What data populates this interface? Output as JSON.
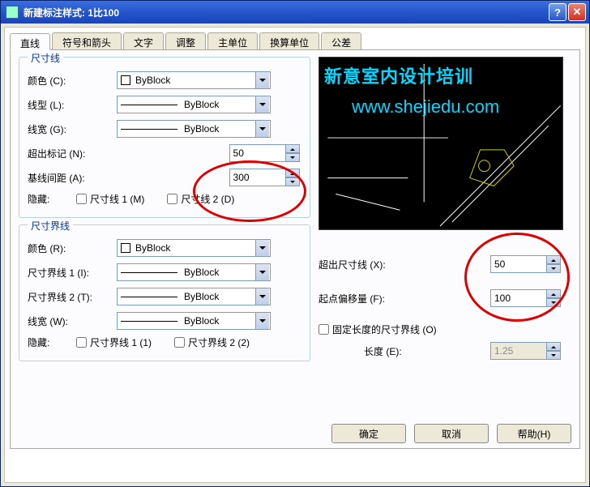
{
  "window": {
    "title": "新建标注样式: 1比100"
  },
  "tabs": [
    "直线",
    "符号和箭头",
    "文字",
    "调整",
    "主单位",
    "换算单位",
    "公差"
  ],
  "dimline": {
    "legend": "尺寸线",
    "color_label": "颜色 (C):",
    "color_value": "ByBlock",
    "ltype_label": "线型 (L):",
    "ltype_value": "ByBlock",
    "lweight_label": "线宽 (G):",
    "lweight_value": "ByBlock",
    "extend_label": "超出标记 (N):",
    "extend_value": "50",
    "baseline_label": "基线间距 (A):",
    "baseline_value": "300",
    "hide_label": "隐藏:",
    "hide1": "尺寸线 1 (M)",
    "hide2": "尺寸线 2 (D)"
  },
  "extline": {
    "legend": "尺寸界线",
    "color_label": "颜色 (R):",
    "color_value": "ByBlock",
    "lt1_label": "尺寸界线 1 (I):",
    "lt1_value": "ByBlock",
    "lt2_label": "尺寸界线 2 (T):",
    "lt2_value": "ByBlock",
    "lweight_label": "线宽 (W):",
    "lweight_value": "ByBlock",
    "hide_label": "隐藏:",
    "hide1": "尺寸界线 1 (1)",
    "hide2": "尺寸界线 2 (2)",
    "beyond_label": "超出尺寸线 (X):",
    "beyond_value": "50",
    "offset_label": "起点偏移量 (F):",
    "offset_value": "100",
    "fixed_label": "固定长度的尺寸界线 (O)",
    "length_label": "长度 (E):",
    "length_value": "1.25"
  },
  "buttons": {
    "ok": "确定",
    "cancel": "取消",
    "help": "帮助(H)"
  },
  "overlay": {
    "title": "新意室内设计培训",
    "url": "www.shejiedu.com"
  }
}
